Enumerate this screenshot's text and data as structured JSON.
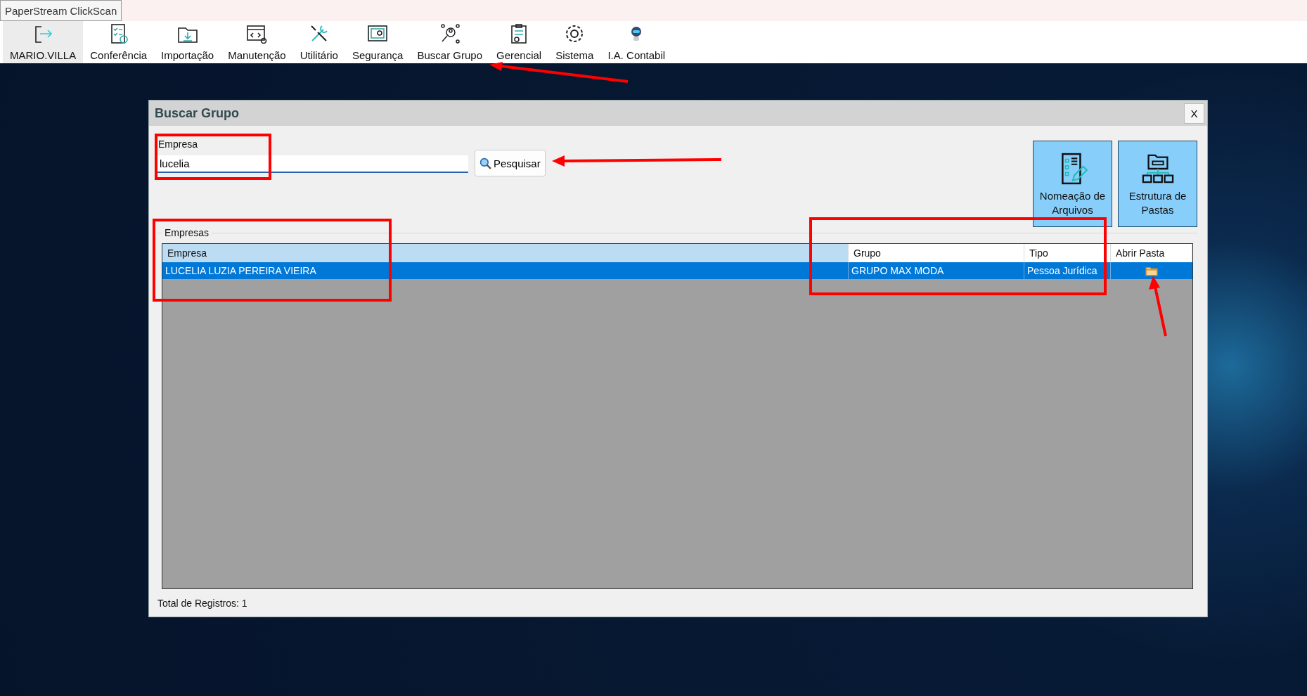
{
  "window": {
    "title": "PaperStream ClickScan"
  },
  "toolbar": {
    "items": [
      {
        "label": "MARIO.VILLA",
        "selected": true
      },
      {
        "label": "Conferência",
        "selected": false
      },
      {
        "label": "Importação",
        "selected": false
      },
      {
        "label": "Manutenção",
        "selected": false
      },
      {
        "label": "Utilitário",
        "selected": false
      },
      {
        "label": "Segurança",
        "selected": false
      },
      {
        "label": "Buscar Grupo",
        "selected": false
      },
      {
        "label": "Gerencial",
        "selected": false
      },
      {
        "label": "Sistema",
        "selected": false
      },
      {
        "label": "I.A. Contabil",
        "selected": false
      }
    ]
  },
  "dialog": {
    "title": "Buscar Grupo",
    "close": "X",
    "search": {
      "label": "Empresa",
      "value": "lucelia",
      "button": "Pesquisar"
    },
    "actions": [
      {
        "label": "Nomeação de Arquivos"
      },
      {
        "label": "Estrutura de Pastas"
      }
    ],
    "group_title": "Empresas",
    "table": {
      "columns": [
        {
          "label": "Empresa",
          "selected": true
        },
        {
          "label": "Grupo",
          "selected": false
        },
        {
          "label": "Tipo",
          "selected": false
        },
        {
          "label": "Abrir Pasta",
          "selected": false
        }
      ],
      "rows": [
        {
          "selected": true,
          "cells": [
            "LUCELIA LUZIA PEREIRA VIEIRA",
            "GRUPO MAX MODA",
            "Pessoa Jurídica"
          ],
          "folder": true
        }
      ]
    },
    "status": "Total de Registros: 1"
  }
}
